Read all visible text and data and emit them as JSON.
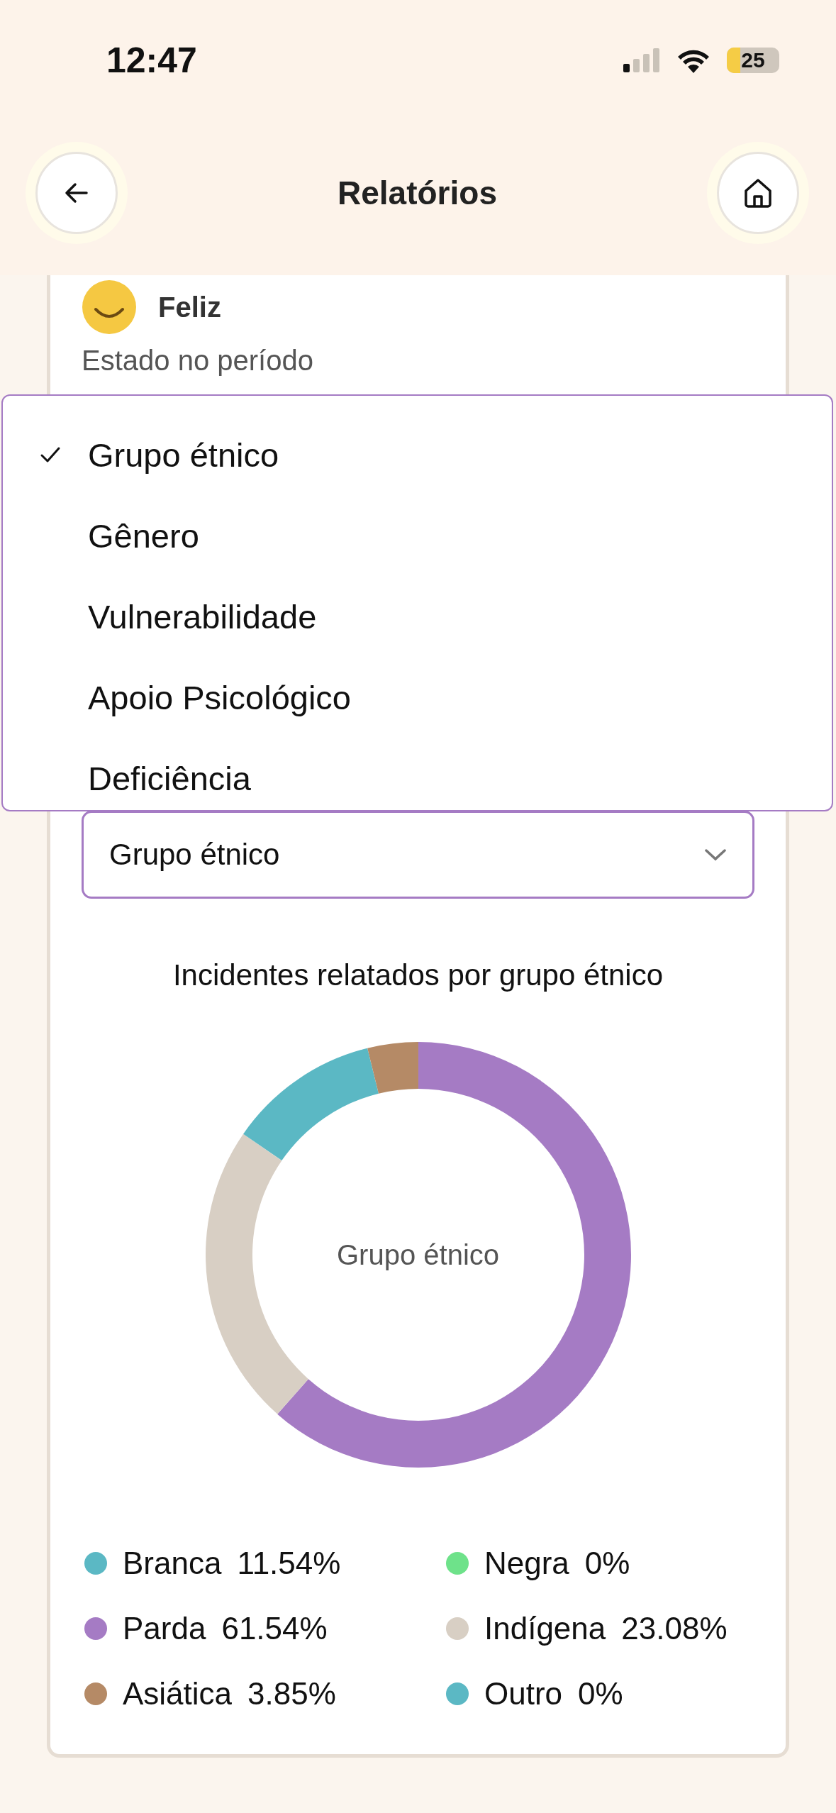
{
  "status_bar": {
    "time": "12:47",
    "battery": "25"
  },
  "header": {
    "title": "Relatórios"
  },
  "card": {
    "mood": "Feliz",
    "state_label": "Estado no período"
  },
  "menu": {
    "items": [
      {
        "label": "Grupo étnico",
        "selected": true
      },
      {
        "label": "Gênero",
        "selected": false
      },
      {
        "label": "Vulnerabilidade",
        "selected": false
      },
      {
        "label": "Apoio Psicológico",
        "selected": false
      },
      {
        "label": "Deficiência",
        "selected": false
      }
    ]
  },
  "select": {
    "value": "Grupo étnico"
  },
  "chart_data": {
    "type": "donut",
    "title": "Incidentes relatados por grupo étnico",
    "categories": [
      "Branca",
      "Negra",
      "Parda",
      "Indígena",
      "Asiática",
      "Outro"
    ],
    "series": [
      {
        "name": "Grupo étnico",
        "colors": [
          "#5bb8c4",
          "#6ee28a",
          "#a57bc4",
          "#d8cfc4",
          "#b58a66",
          "#5bb8c4"
        ],
        "values": [
          11.54,
          0,
          61.54,
          23.08,
          3.85,
          0
        ]
      }
    ],
    "value_labels": [
      "11.54%",
      "0%",
      "61.54%",
      "23.08%",
      "3.85%",
      "0%"
    ]
  }
}
